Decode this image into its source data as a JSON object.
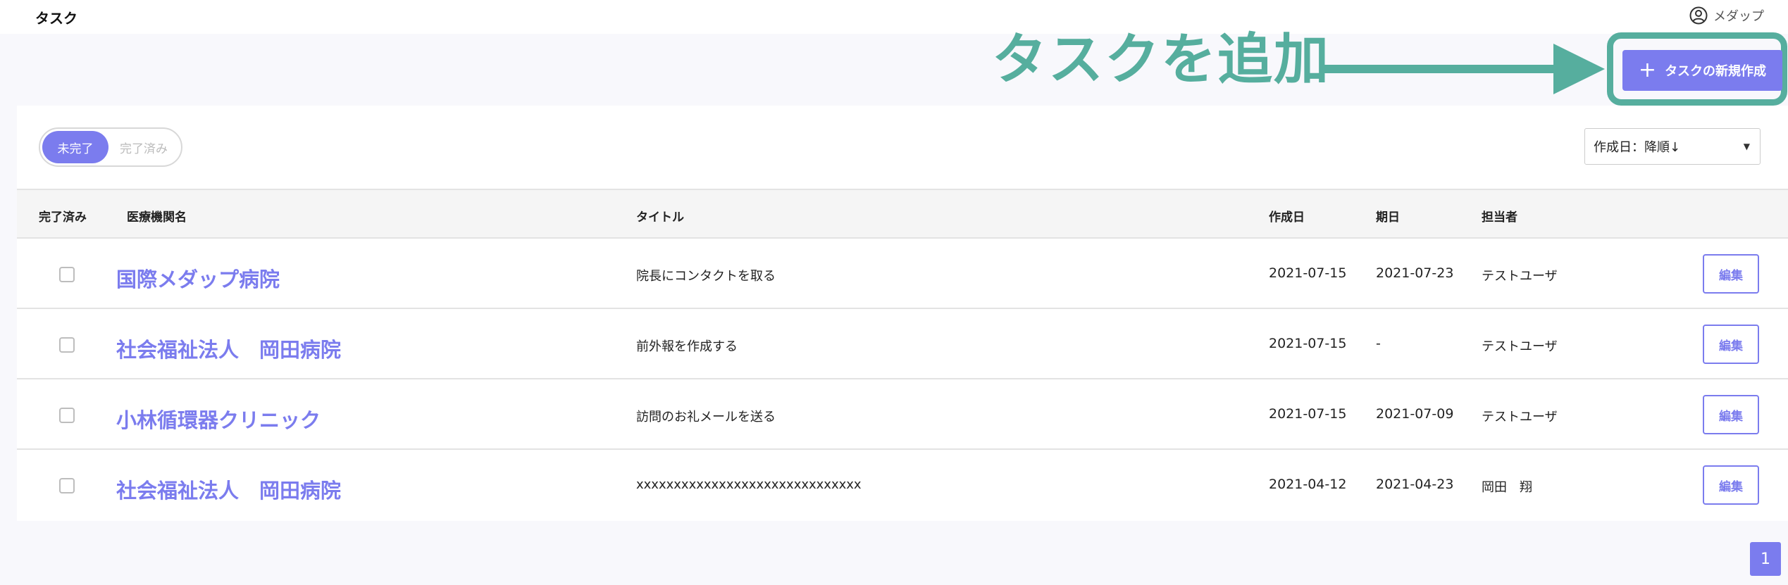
{
  "app": {
    "title": "タスク"
  },
  "user": {
    "name": "メダップ",
    "icon": "user-circle-icon"
  },
  "annotation": {
    "text": "タスクを追加",
    "color": "#56ae9e"
  },
  "toolbar": {
    "new_task_label": "タスクの新規作成",
    "accent": "#7b7cee"
  },
  "filter": {
    "incomplete_label": "未完了",
    "complete_label": "完了済み",
    "selected": "未完了"
  },
  "sort": {
    "selected_label": "作成日：降順↓"
  },
  "table": {
    "headers": {
      "done": "完了済み",
      "org": "医療機関名",
      "title": "タイトル",
      "created": "作成日",
      "due": "期日",
      "assignee": "担当者"
    },
    "rows": [
      {
        "done": false,
        "org": "国際メダップ病院",
        "title": "院長にコンタクトを取る",
        "created": "2021-07-15",
        "due": "2021-07-23",
        "assignee": "テストユーザ",
        "edit_label": "編集"
      },
      {
        "done": false,
        "org": "社会福祉法人　岡田病院",
        "title": "前外報を作成する",
        "created": "2021-07-15",
        "due": "-",
        "assignee": "テストユーザ",
        "edit_label": "編集"
      },
      {
        "done": false,
        "org": "小林循環器クリニック",
        "title": "訪問のお礼メールを送る",
        "created": "2021-07-15",
        "due": "2021-07-09",
        "assignee": "テストユーザ",
        "edit_label": "編集"
      },
      {
        "done": false,
        "org": "社会福祉法人　岡田病院",
        "title": "xxxxxxxxxxxxxxxxxxxxxxxxxxxxxx",
        "created": "2021-04-12",
        "due": "2021-04-23",
        "assignee": "岡田　翔",
        "edit_label": "編集"
      }
    ]
  },
  "pagination": {
    "current_page": "1"
  }
}
